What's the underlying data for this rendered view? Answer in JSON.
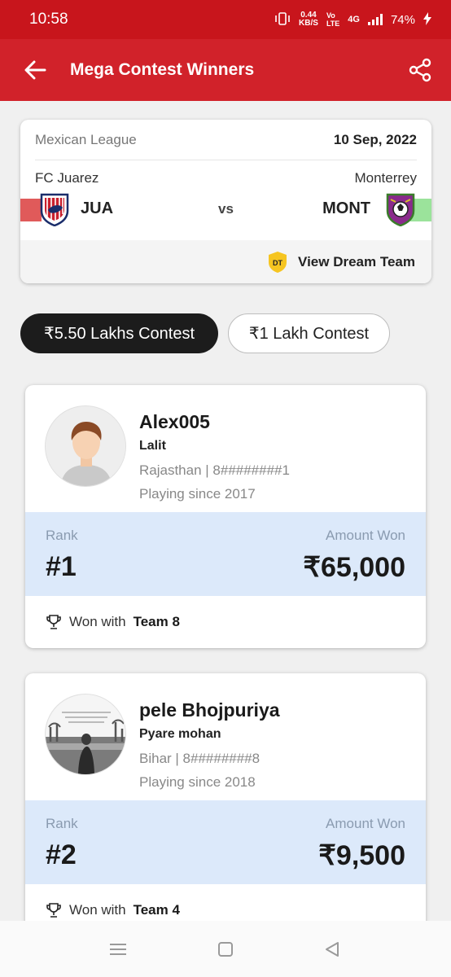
{
  "status_bar": {
    "time": "10:58",
    "net_speed": "0.44\nKB/S",
    "volte": "Vó",
    "network": "4G",
    "battery": "74%"
  },
  "app_bar": {
    "title": "Mega Contest Winners"
  },
  "match": {
    "league": "Mexican League",
    "date": "10 Sep, 2022",
    "home_team": "FC Juarez",
    "away_team": "Monterrey",
    "home_short": "JUA",
    "away_short": "MONT",
    "vs": "vs",
    "dream_badge": "DT",
    "dream_label": "View Dream Team"
  },
  "contest_tabs": [
    {
      "label": "₹5.50 Lakhs Contest",
      "active": true
    },
    {
      "label": "₹1 Lakh Contest",
      "active": false
    }
  ],
  "winners": [
    {
      "username": "Alex005",
      "real_name": "Lalit",
      "location": "Rajasthan | 8########1",
      "since": "Playing since 2017",
      "rank_label": "Rank",
      "amount_label": "Amount Won",
      "rank": "#1",
      "amount": "₹65,000",
      "won_prefix": "Won with",
      "team": "Team 8"
    },
    {
      "username": "pele Bhojpuriya",
      "real_name": "Pyare mohan",
      "location": "Bihar | 8########8",
      "since": "Playing since 2018",
      "rank_label": "Rank",
      "amount_label": "Amount Won",
      "rank": "#2",
      "amount": "₹9,500",
      "won_prefix": "Won with",
      "team": "Team 4"
    }
  ],
  "colors": {
    "status_bar": "#c8151c",
    "app_bar": "#d1222a",
    "rank_band": "#dce9fa",
    "active_tab": "#1c1c1c"
  },
  "icons": [
    "back-arrow-icon",
    "share-icon",
    "trophy-icon",
    "menu-nav-icon",
    "home-nav-icon",
    "back-nav-icon"
  ]
}
